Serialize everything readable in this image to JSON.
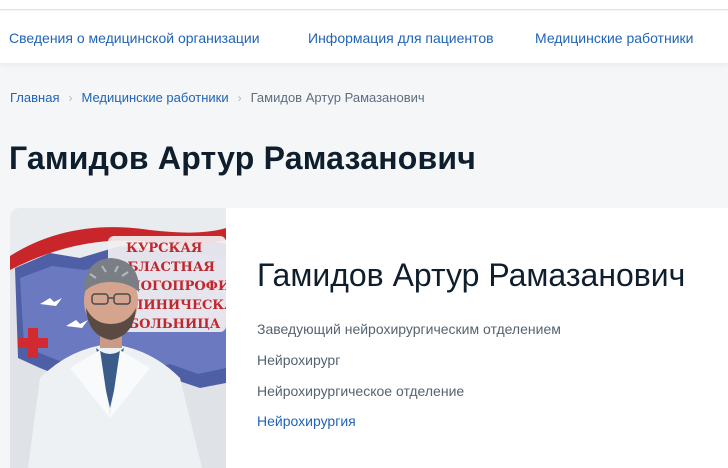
{
  "nav": {
    "items": [
      {
        "label": "Сведения о медицинской организации"
      },
      {
        "label": "Информация для пациентов"
      },
      {
        "label": "Медицинские работники"
      }
    ]
  },
  "breadcrumb": {
    "home": "Главная",
    "section": "Медицинские работники",
    "current": "Гамидов Артур Рамазанович"
  },
  "page": {
    "title": "Гамидов Артур Рамазанович"
  },
  "profile": {
    "name": "Гамидов Артур Рамазанович",
    "position": "Заведующий нейрохирургическим отделением",
    "specialty": "Нейрохирург",
    "department": "Нейрохирургическое отделение",
    "profile_link": "Нейрохирургия",
    "photo_sign_text": [
      "КУРСКАЯ",
      "ОБЛАСТНАЯ",
      "МНОГОПРОФИЛЬНАЯ",
      "КЛИНИЧЕСКАЯ",
      "БОЛЬНИЦА"
    ]
  },
  "colors": {
    "link": "#2164b7",
    "title": "#0f1e2d",
    "muted": "#55636f",
    "background": "#f4f6f8"
  }
}
